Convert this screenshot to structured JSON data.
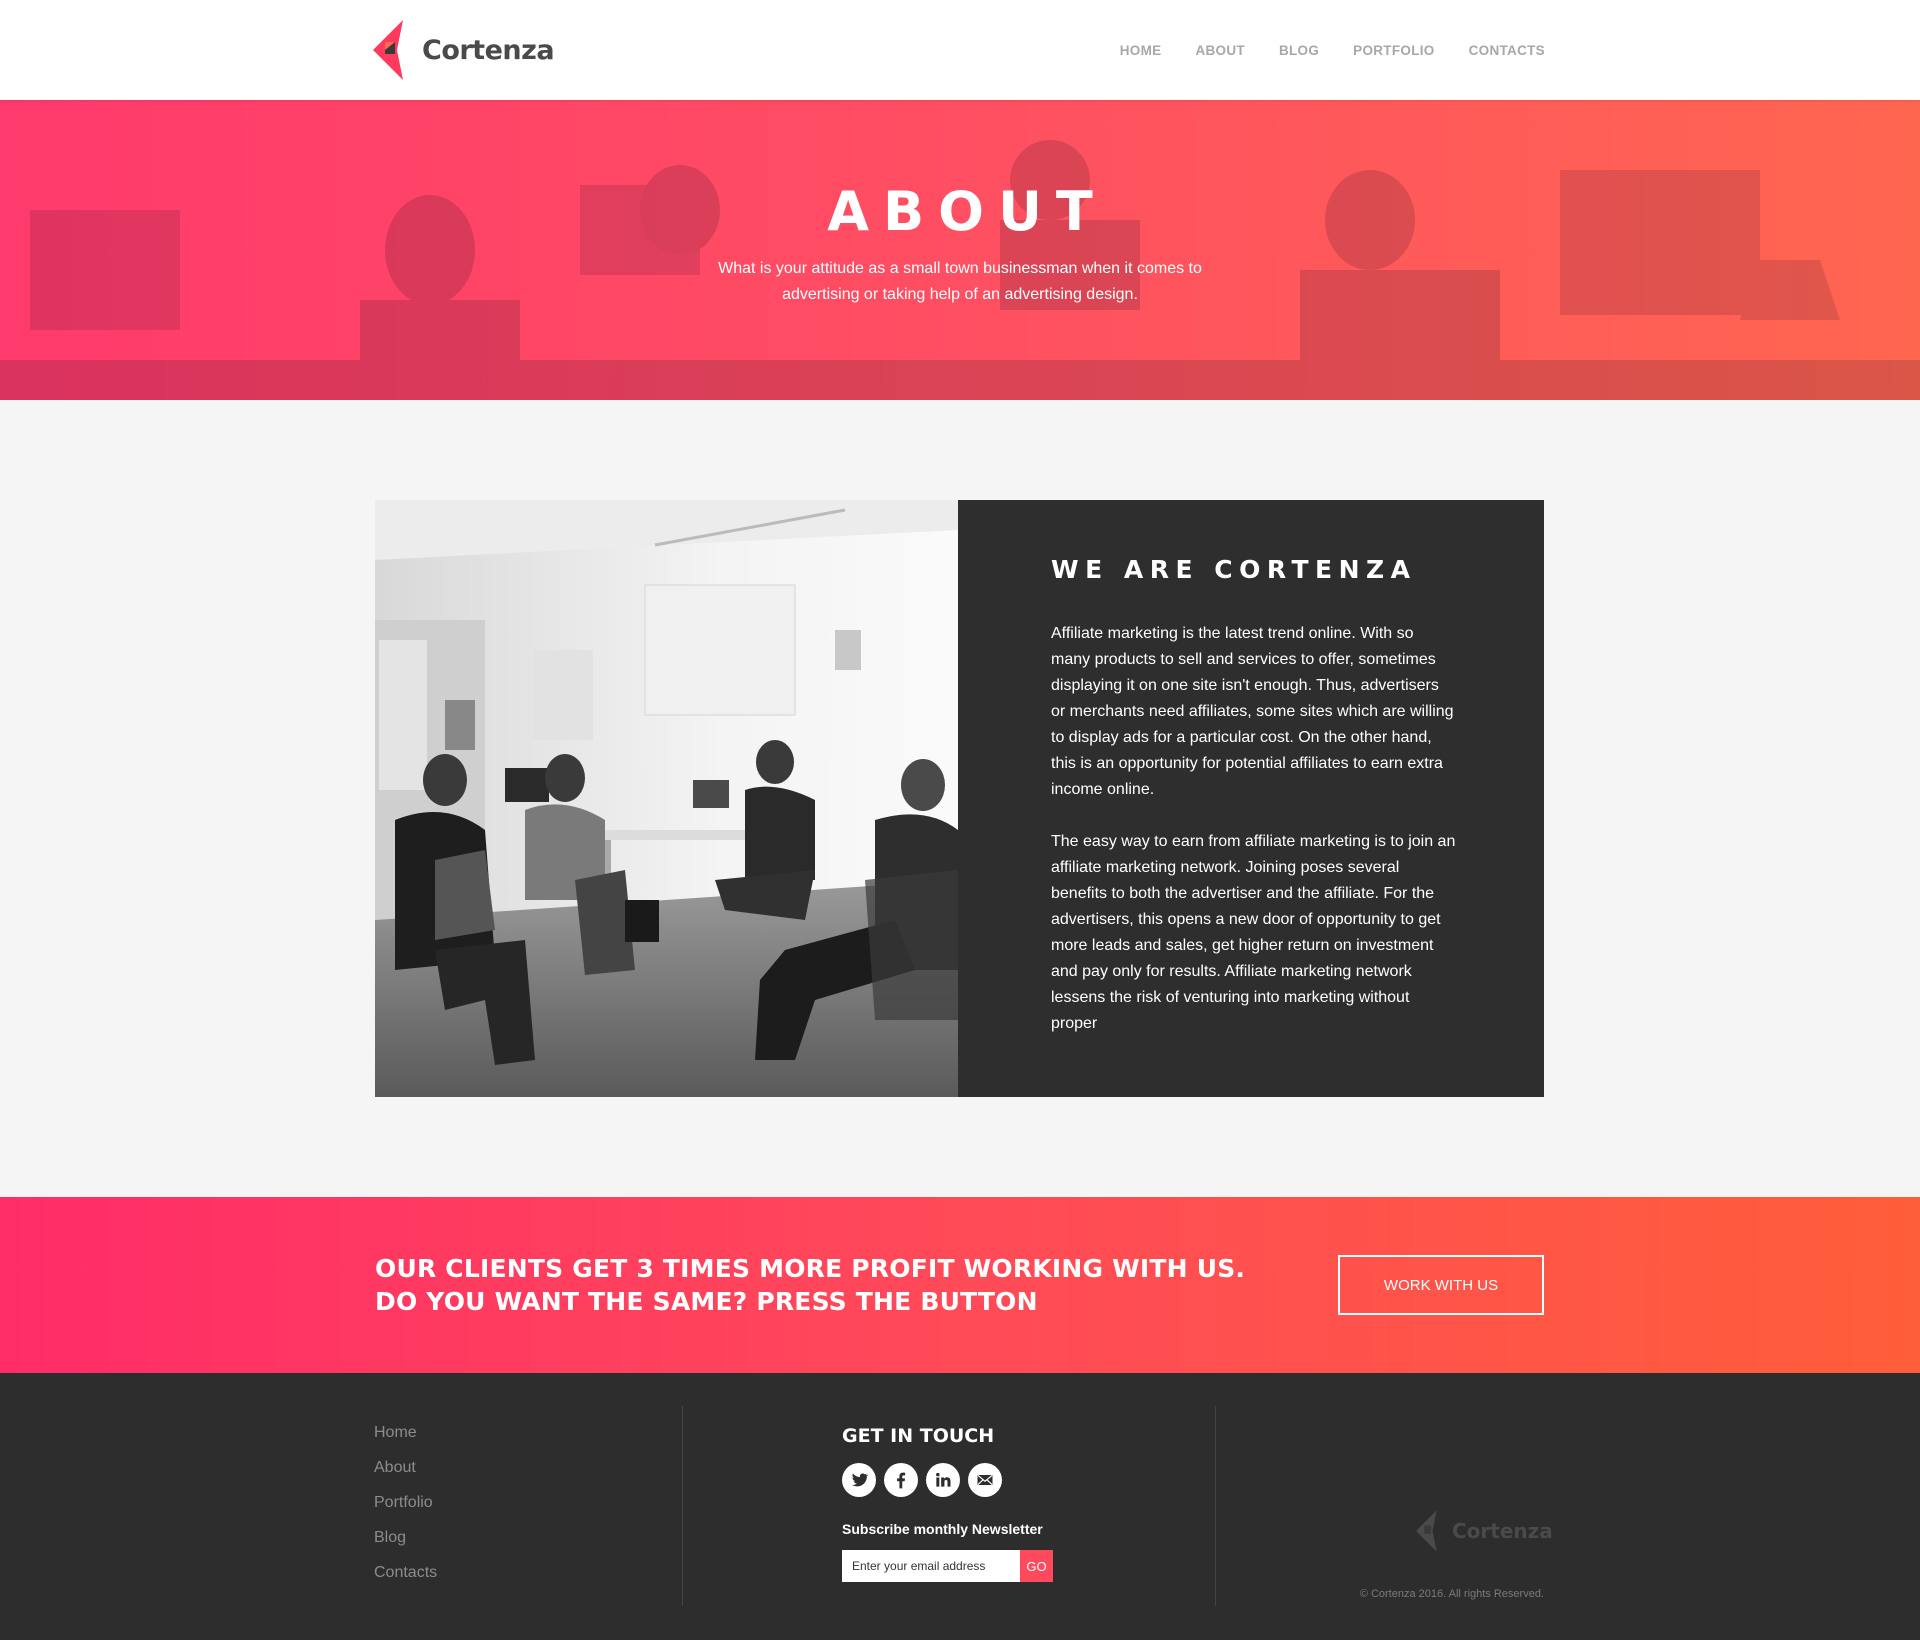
{
  "brand": {
    "name": "Cortenza"
  },
  "nav": {
    "items": [
      "HOME",
      "ABOUT",
      "BLOG",
      "PORTFOLIO",
      "CONTACTS"
    ]
  },
  "hero": {
    "title": "ABOUT",
    "subtitle": "What is your attitude as a small town businessman when it comes to advertising or taking help of an advertising design."
  },
  "about": {
    "heading": "WE ARE CORTENZA",
    "paragraphs": [
      "Affiliate marketing is the latest trend online. With so many products to sell and services to offer, sometimes displaying it on one site isn't enough. Thus, advertisers or merchants need affiliates, some sites which are willing to display ads for a particular cost. On the other hand, this is an opportunity for potential affiliates to earn extra income online.",
      "The easy way to earn from affiliate marketing is to join an affiliate marketing network. Joining poses several benefits to both the advertiser and the affiliate. For the advertisers, this opens a new door of opportunity to get more leads and sales, get higher return on investment and pay only for results. Affiliate marketing network lessens the risk of venturing into marketing without proper"
    ]
  },
  "cta": {
    "line1": "OUR CLIENTS GET 3 TIMES MORE PROFIT WORKING WITH US.",
    "line2": "DO YOU WANT THE SAME? PRESS THE BUTTON",
    "button": "WORK WITH US"
  },
  "footer": {
    "links": [
      "Home",
      "About",
      "Portfolio",
      "Blog",
      "Contacts"
    ],
    "touch_title": "GET IN TOUCH",
    "socials": [
      "twitter-icon",
      "facebook-icon",
      "linkedin-icon",
      "email-icon"
    ],
    "newsletter_label": "Subscribe monthly Newsletter",
    "newsletter_placeholder": "Enter your email address",
    "newsletter_button": "GO",
    "brand": "Cortenza",
    "copyright": "© Cortenza 2016. All rights Reserved."
  },
  "colors": {
    "accent_pink": "#ff3a6c",
    "accent_orange": "#ff5e3a",
    "dark_panel": "#2e2e2e",
    "footer_bg": "#2d2d2d"
  }
}
